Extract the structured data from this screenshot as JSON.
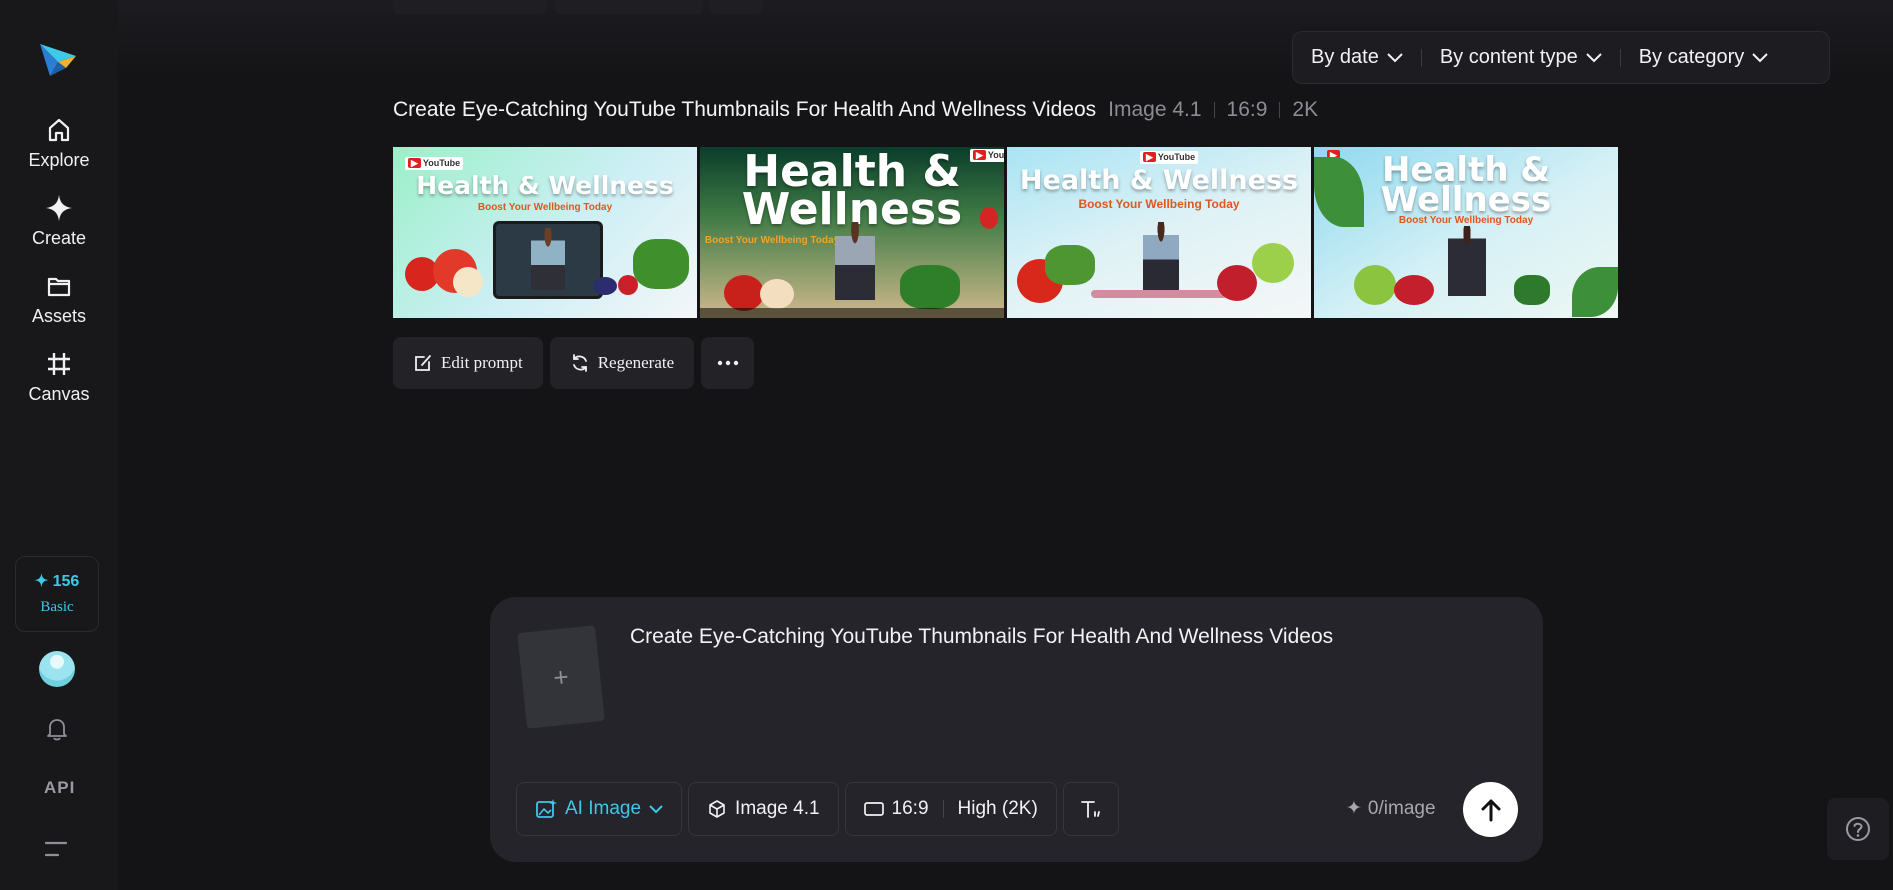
{
  "nav": {
    "items": [
      {
        "label": "Explore",
        "icon": "home-icon"
      },
      {
        "label": "Create",
        "icon": "sparkle-icon"
      },
      {
        "label": "Assets",
        "icon": "folder-icon"
      },
      {
        "label": "Canvas",
        "icon": "crop-icon"
      }
    ],
    "credits": {
      "value": "156",
      "tier": "Basic"
    },
    "api_label": "API"
  },
  "filters": {
    "by_date": "By date",
    "by_content_type": "By content type",
    "by_category": "By category"
  },
  "generation": {
    "title": "Create Eye-Catching YouTube Thumbnails For Health And Wellness Videos",
    "model": "Image 4.1",
    "ratio": "16:9",
    "resolution": "2K",
    "thumbnails": [
      {
        "headline": "Health & Wellness",
        "sub": "Boost Your Wellbeing Today",
        "yt": "YouTube"
      },
      {
        "headline": "Health & Wellness",
        "sub": "Boost Your Wellbeing Today",
        "yt": "YouTube"
      },
      {
        "headline": "Health & Wellness",
        "sub": "Boost Your Wellbeing Today",
        "yt": "YouTube"
      },
      {
        "headline": "Health & Wellness",
        "sub": "Boost Your Wellbeing Today",
        "yt": ""
      }
    ],
    "actions": {
      "edit": "Edit prompt",
      "regenerate": "Regenerate"
    }
  },
  "composer": {
    "prompt": "Create Eye-Catching YouTube Thumbnails For Health And Wellness Videos",
    "mode": "AI Image",
    "model": "Image 4.1",
    "ratio": "16:9",
    "quality": "High (2K)",
    "cost": "0/image"
  },
  "colors": {
    "accent": "#3ec9e6",
    "background": "#141417",
    "panel": "#24242a"
  }
}
